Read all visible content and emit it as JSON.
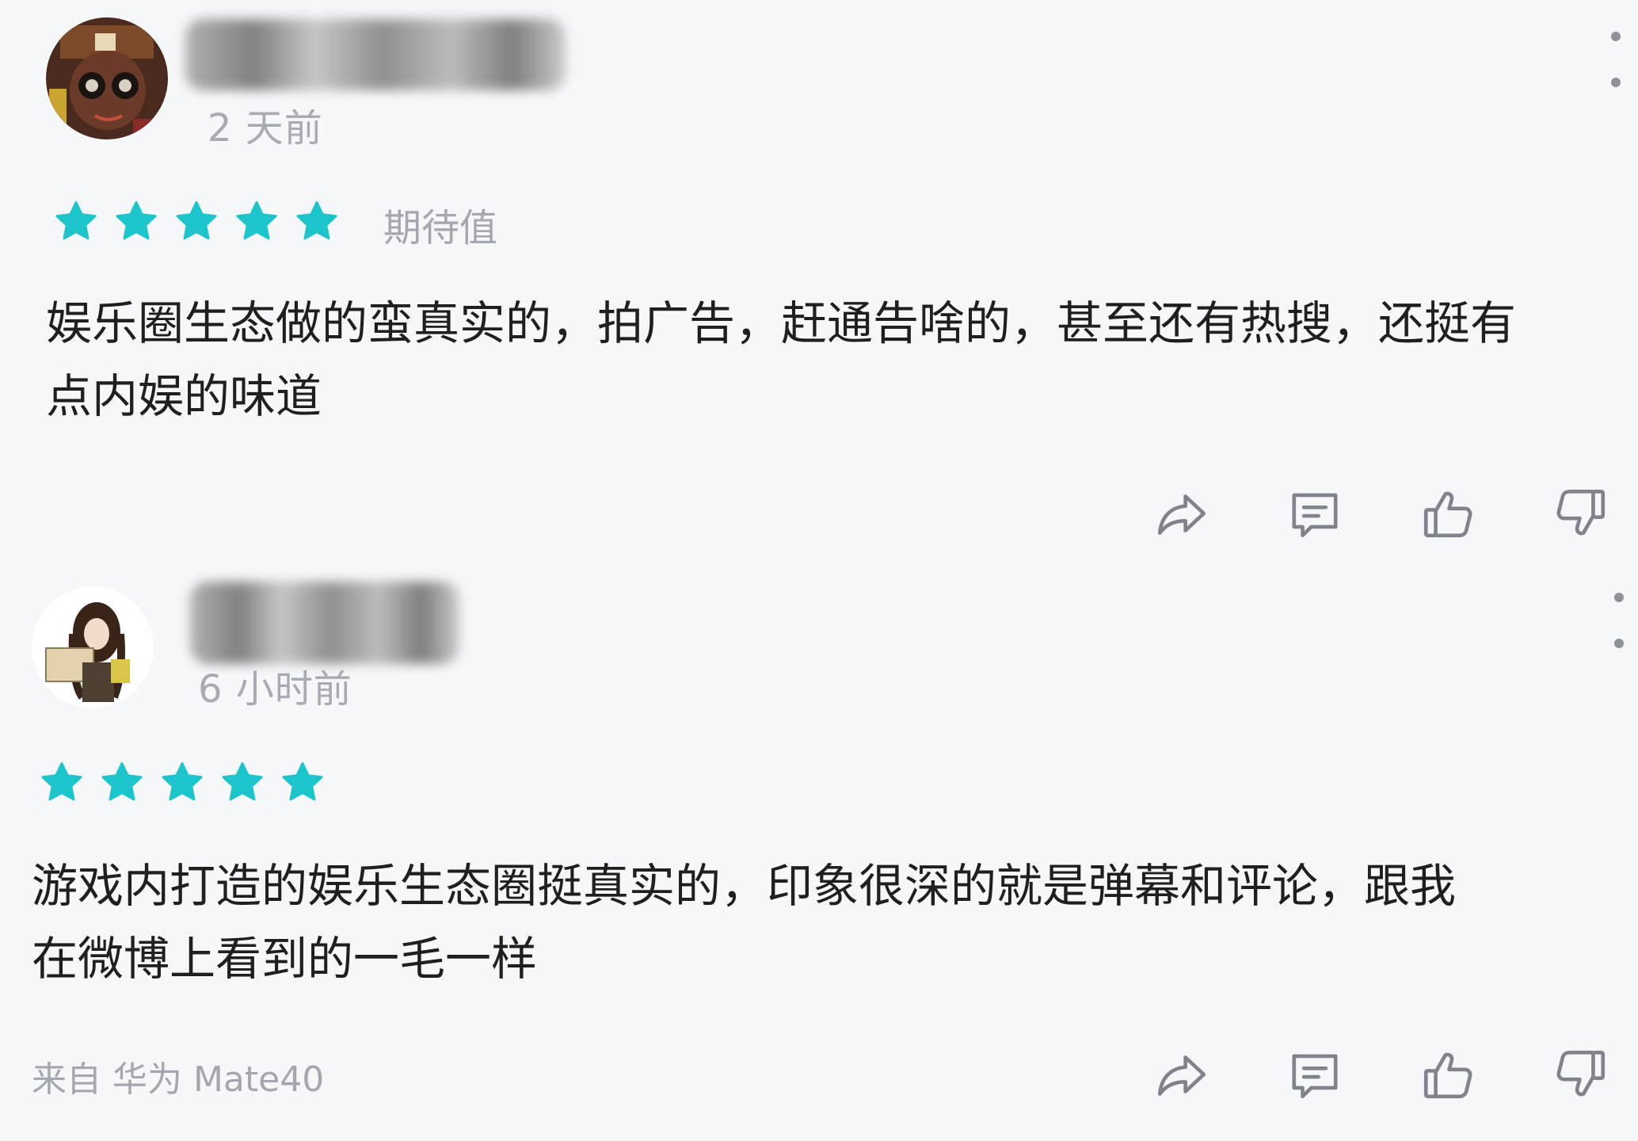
{
  "reviews": [
    {
      "time": "2 天前",
      "rating": 5,
      "rating_label": "期待值",
      "text_line1": "娱乐圈生态做的蛮真实的，拍广告，赶通告啥的，甚至还有热搜，还挺有",
      "text_line2": "点内娱的味道",
      "source": ""
    },
    {
      "time": "6 小时前",
      "rating": 5,
      "rating_label": "",
      "text_line1": "游戏内打造的娱乐生态圈挺真实的，印象很深的就是弹幕和评论，跟我",
      "text_line2": "在微博上看到的一毛一样",
      "source": "来自 华为 Mate40"
    }
  ],
  "colors": {
    "star": "#1cc4cc",
    "icon": "#7f848c",
    "background": "#f6f7f9"
  },
  "icons": [
    "share-icon",
    "comment-icon",
    "thumbs-up-icon",
    "thumbs-down-icon",
    "more-icon",
    "star-icon"
  ]
}
